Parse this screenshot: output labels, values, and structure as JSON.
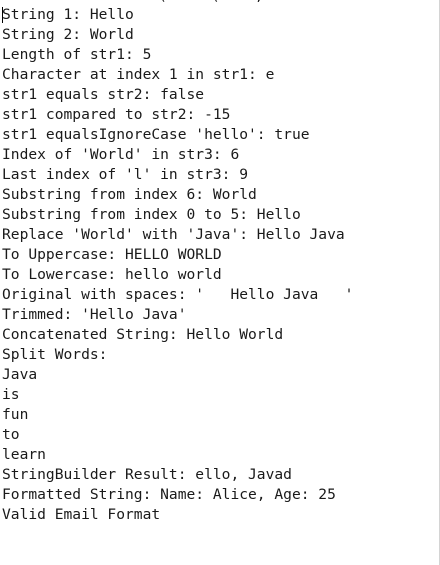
{
  "console": {
    "clipped_top_text": "                  ( ... ( ...,",
    "lines": [
      "String 1: Hello",
      "String 2: World",
      "Length of str1: 5",
      "Character at index 1 in str1: e",
      "str1 equals str2: false",
      "str1 compared to str2: -15",
      "str1 equalsIgnoreCase 'hello': true",
      "Index of 'World' in str3: 6",
      "Last index of 'l' in str3: 9",
      "Substring from index 6: World",
      "Substring from index 0 to 5: Hello",
      "Replace 'World' with 'Java': Hello Java",
      "To Uppercase: HELLO WORLD",
      "To Lowercase: hello world",
      "Original with spaces: '   Hello Java   '",
      "Trimmed: 'Hello Java'",
      "Concatenated String: Hello World",
      "Split Words:",
      "Java",
      "is",
      "fun",
      "to",
      "learn",
      "StringBuilder Result: ello, Javad",
      "Formatted String: Name: Alice, Age: 25",
      "Valid Email Format"
    ]
  }
}
